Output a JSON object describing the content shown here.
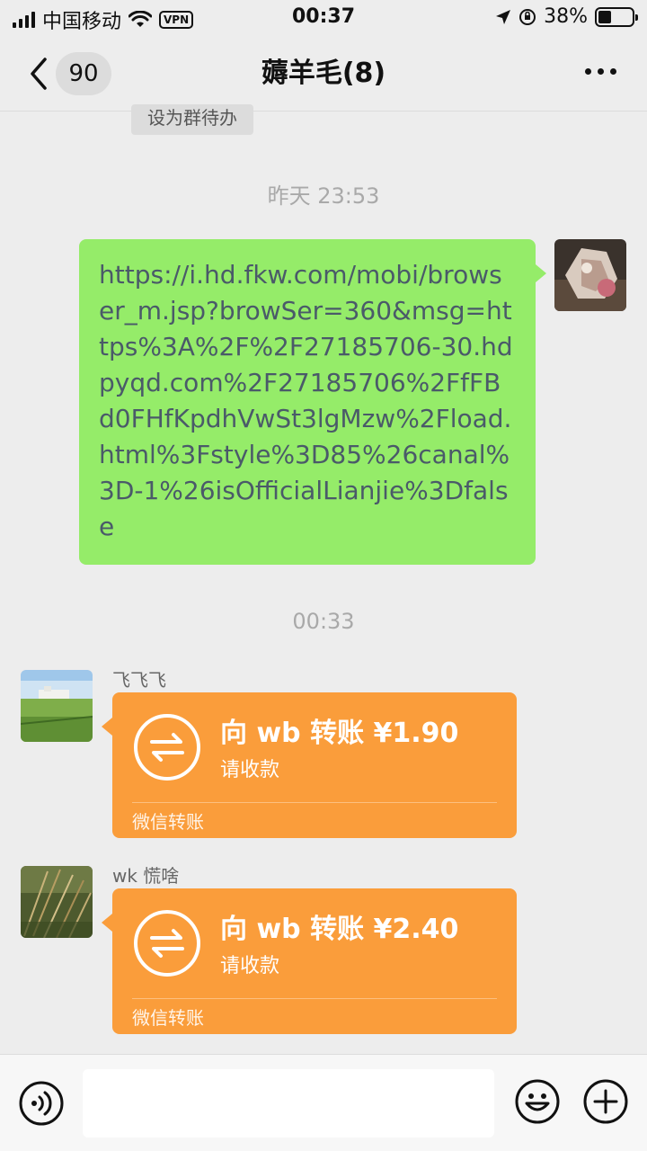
{
  "status_bar": {
    "carrier": "中国移动",
    "vpn": "VPN",
    "time": "00:37",
    "battery": "38%",
    "battery_level": 0.38
  },
  "nav": {
    "unread_count": "90",
    "title": "薅羊毛(8)"
  },
  "todo_chip": "设为群待办",
  "messages": [
    {
      "type": "time",
      "text": "昨天 23:53"
    },
    {
      "type": "text_out",
      "text": "https://i.hd.fkw.com/mobi/browser_m.jsp?browSer=360&msg=https%3A%2F%2F27185706-30.hdpyqd.com%2F27185706%2FfFBd0FHfKpdhVwSt3lgMzw%2Fload.html%3Fstyle%3D85%26canal%3D-1%26isOfficialLianjie%3Dfalse"
    },
    {
      "type": "time",
      "text": "00:33"
    },
    {
      "type": "transfer_in",
      "sender": "飞飞飞",
      "title": "向 wb 转账 ¥1.90",
      "subtitle": "请收款",
      "footer": "微信转账"
    },
    {
      "type": "transfer_in",
      "sender": "wk 慌啥",
      "title": "向 wb 转账 ¥2.40",
      "subtitle": "请收款",
      "footer": "微信转账"
    }
  ],
  "input_bar": {
    "value": ""
  },
  "colors": {
    "background": "#ededed",
    "outgoing_bubble": "#95ec69",
    "transfer_card": "#fa9d3b",
    "link_text": "#4a5a69"
  }
}
